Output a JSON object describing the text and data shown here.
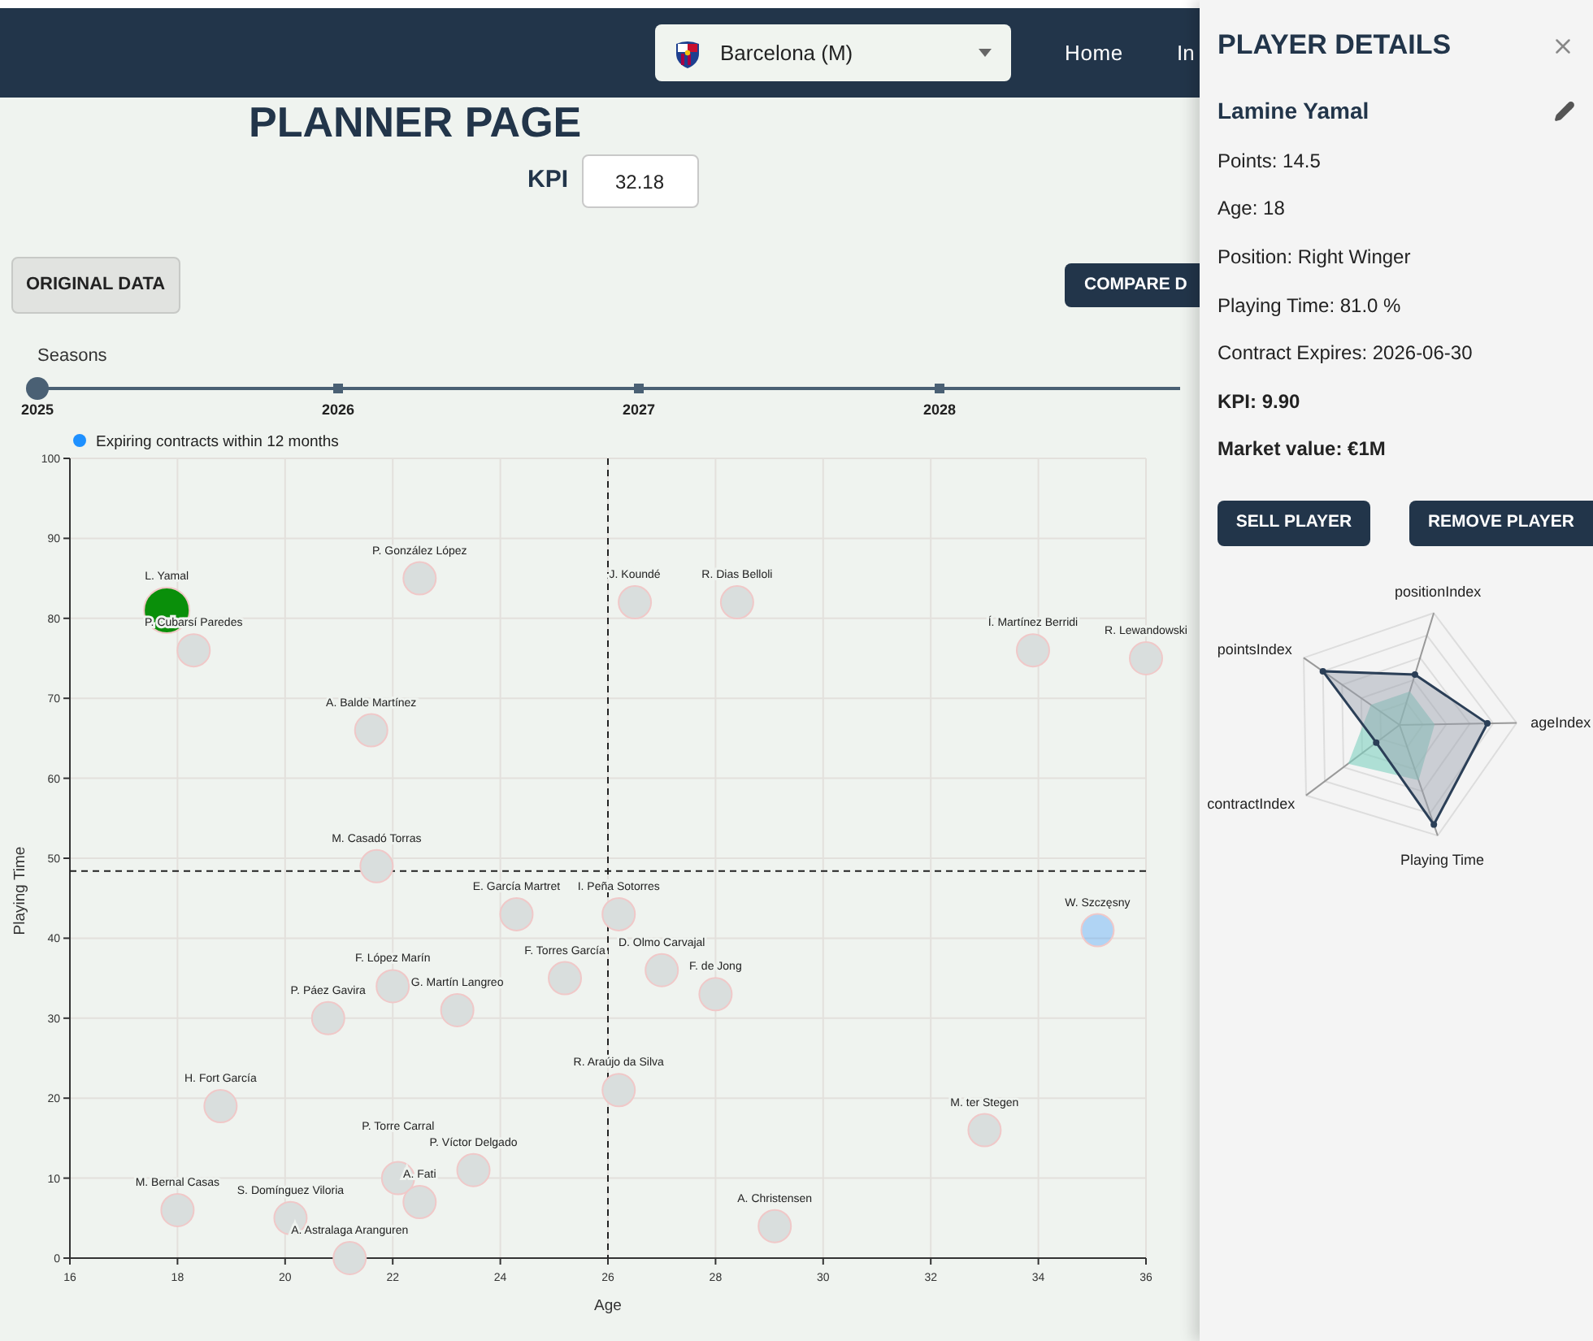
{
  "nav": {
    "team_select": {
      "value": "Barcelona (M)"
    },
    "links": [
      {
        "label": "Home"
      },
      {
        "label": "In"
      }
    ]
  },
  "title": "PLANNER PAGE",
  "kpi": {
    "label": "KPI",
    "value": "32.18"
  },
  "buttons": [
    {
      "label": "ORIGINAL DATA",
      "kind": "secondary"
    },
    {
      "label": "COMPARE D",
      "kind": "primary"
    }
  ],
  "seasons": {
    "label": "Seasons",
    "level": 0,
    "marks": [
      "2025",
      "2026",
      "2027",
      "2028"
    ]
  },
  "chart": {
    "chart_data": {
      "type": "scatter",
      "xlabel": "Age",
      "ylabel": "Playing Time",
      "xlim": [
        16,
        36
      ],
      "ylim": [
        0,
        100
      ],
      "xticks": [
        16,
        18,
        20,
        22,
        24,
        26,
        28,
        30,
        32,
        34,
        36
      ],
      "yticks": [
        0,
        10,
        20,
        30,
        40,
        50,
        60,
        70,
        80,
        90,
        100
      ],
      "grid": true,
      "series": [
        {
          "color": "#0a8f0a",
          "value_labels": [
            "L. Yamal"
          ],
          "x": [
            17.8
          ],
          "values": [
            81
          ]
        },
        {
          "name": "Expiring contracts within 12 months",
          "color": "#1e90ff",
          "value_labels": [
            "W. Szczęsny"
          ],
          "x": [
            35.1
          ],
          "values": [
            41
          ]
        },
        {
          "color": "#d9dedd",
          "value_labels": [
            "P. Cubarsí Paredes",
            "P. González López",
            "J. Koundé",
            "R. Dias Belloli",
            "Í. Martínez Berridi",
            "R. Lewandowski",
            "A. Balde Martínez",
            "M. Casadó Torras",
            "E. García Martret",
            "I. Peña Sotorres",
            "F. López Marín",
            "F. Torres García",
            "D. Olmo Carvajal",
            "F. de Jong",
            "G. Martín Langreo",
            "P. Páez Gavira",
            "R. Araújo da Silva",
            "H. Fort García",
            "M. ter Stegen",
            "P. Víctor Delgado",
            "P. Torre Carral",
            "A. Fati",
            "M. Bernal Casas",
            "S. Domínguez Viloria",
            "A. Christensen",
            "A. Astralaga Aranguren"
          ],
          "x": [
            18.3,
            22.5,
            26.5,
            28.4,
            33.9,
            36,
            21.6,
            21.7,
            24.3,
            26.2,
            22,
            25.2,
            27,
            28,
            23.2,
            20.8,
            26.2,
            18.8,
            33,
            23.5,
            22.1,
            22.5,
            18,
            20.1,
            29.1,
            21.2
          ],
          "values": [
            76,
            85,
            82,
            82,
            76,
            75,
            66,
            49,
            43,
            43,
            34,
            35,
            36,
            33,
            31,
            30,
            21,
            19,
            16,
            11,
            10,
            7,
            6,
            5,
            4,
            0
          ]
        }
      ],
      "ref_lines": [
        {
          "axis": "x",
          "value": 26
        },
        {
          "axis": "y",
          "value": 48.4
        }
      ]
    }
  },
  "drawer": {
    "title": "PLAYER DETAILS",
    "player_name": "Lamine Yamal",
    "fields": [
      {
        "text": "Points: 14.5",
        "bold": false
      },
      {
        "text": "Age: 18",
        "bold": false
      },
      {
        "text": "Position: Right Winger",
        "bold": false
      },
      {
        "text": "Playing Time: 81.0 %",
        "bold": false
      },
      {
        "text": "Contract Expires: 2026-06-30",
        "bold": false
      },
      {
        "text": "KPI: 9.90",
        "bold": true
      },
      {
        "text": "Market value: €1M",
        "bold": true
      }
    ],
    "buttons": [
      {
        "label": "SELL PLAYER"
      },
      {
        "label": "REMOVE PLAYER"
      }
    ],
    "radar": {
      "axes": [
        "positionIndex",
        "ageIndex",
        "Playing Time",
        "contractIndex",
        "pointsIndex"
      ]
    }
  }
}
